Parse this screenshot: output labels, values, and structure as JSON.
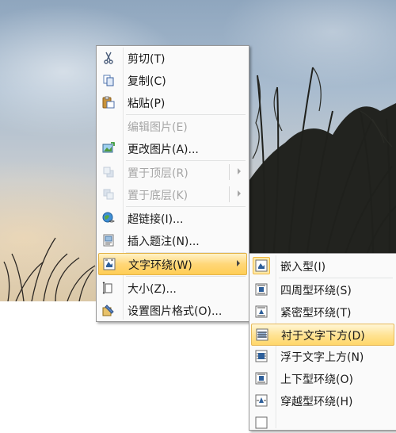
{
  "context_menu": {
    "items": [
      {
        "label": "剪切(T)",
        "icon": "scissors-icon",
        "enabled": true
      },
      {
        "label": "复制(C)",
        "icon": "copy-icon",
        "enabled": true
      },
      {
        "label": "粘贴(P)",
        "icon": "paste-icon",
        "enabled": true
      },
      {
        "label": "编辑图片(E)",
        "icon": "",
        "enabled": false
      },
      {
        "label": "更改图片(A)...",
        "icon": "change-picture-icon",
        "enabled": true
      },
      {
        "label": "置于顶层(R)",
        "icon": "bring-to-front-icon",
        "enabled": false,
        "submenu": true
      },
      {
        "label": "置于底层(K)",
        "icon": "send-to-back-icon",
        "enabled": false,
        "submenu": true
      },
      {
        "label": "超链接(I)...",
        "icon": "hyperlink-icon",
        "enabled": true
      },
      {
        "label": "插入题注(N)...",
        "icon": "caption-icon",
        "enabled": true
      },
      {
        "label": "文字环绕(W)",
        "icon": "text-wrap-icon",
        "enabled": true,
        "submenu": true,
        "active": true
      },
      {
        "label": "大小(Z)...",
        "icon": "size-icon",
        "enabled": true
      },
      {
        "label": "设置图片格式(O)...",
        "icon": "format-picture-icon",
        "enabled": true
      }
    ]
  },
  "wrap_submenu": {
    "items": [
      {
        "label": "嵌入型(I)",
        "icon": "inline-wrap-icon",
        "current": true
      },
      {
        "label": "四周型环绕(S)",
        "icon": "square-wrap-icon"
      },
      {
        "label": "紧密型环绕(T)",
        "icon": "tight-wrap-icon"
      },
      {
        "label": "衬于文字下方(D)",
        "icon": "behind-text-icon",
        "hovered": true
      },
      {
        "label": "浮于文字上方(N)",
        "icon": "in-front-text-icon"
      },
      {
        "label": "上下型环绕(O)",
        "icon": "top-bottom-wrap-icon"
      },
      {
        "label": "穿越型环绕(H)",
        "icon": "through-wrap-icon"
      }
    ]
  },
  "colors": {
    "hover_gradient_top": "#fff2c8",
    "hover_gradient_bottom": "#ffcd55",
    "disabled_text": "#a6a6a6"
  }
}
